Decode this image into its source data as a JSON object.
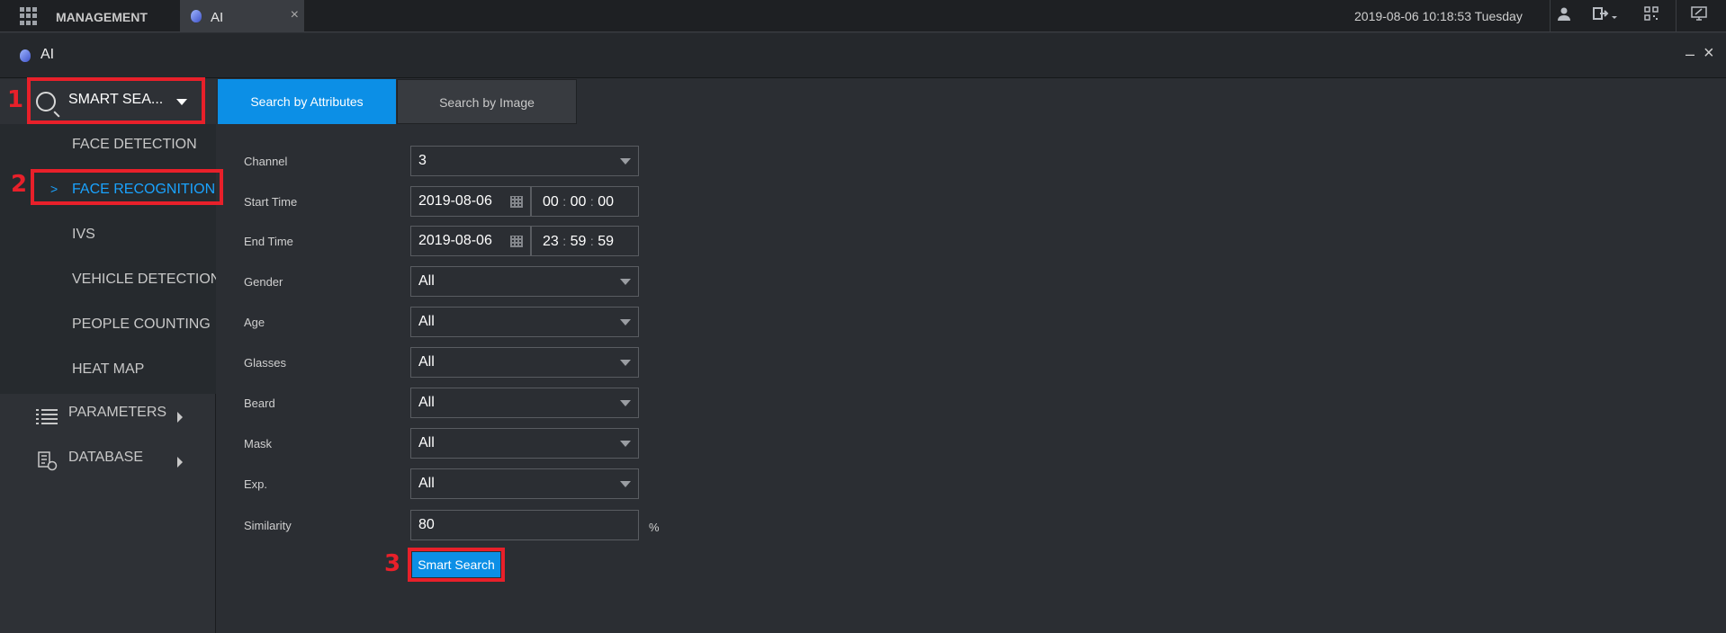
{
  "topbar": {
    "management_label": "MANAGEMENT",
    "tab_label": "AI",
    "tab_close": "×",
    "datetime": "2019-08-06 10:18:53 Tuesday",
    "icons": [
      "user-icon",
      "logout-icon",
      "qr-code-icon",
      "monitor-icon"
    ]
  },
  "window": {
    "title": "AI",
    "minimize": "–",
    "close": "×"
  },
  "sidebar": {
    "smart_search_label": "SMART SEA...",
    "sub_items": [
      {
        "label": "FACE DETECTION",
        "active": false
      },
      {
        "label": "FACE RECOGNITION",
        "active": true
      },
      {
        "label": "IVS",
        "active": false
      },
      {
        "label": "VEHICLE DETECTION",
        "active": false
      },
      {
        "label": "PEOPLE COUNTING",
        "active": false
      },
      {
        "label": "HEAT MAP",
        "active": false
      }
    ],
    "parameters_label": "PARAMETERS",
    "database_label": "DATABASE"
  },
  "tabs": {
    "by_attributes": "Search by Attributes",
    "by_image": "Search by Image"
  },
  "form": {
    "channel": {
      "label": "Channel",
      "value": "3"
    },
    "start_time": {
      "label": "Start Time",
      "date": "2019-08-06",
      "hh": "00",
      "mm": "00",
      "ss": "00"
    },
    "end_time": {
      "label": "End Time",
      "date": "2019-08-06",
      "hh": "23",
      "mm": "59",
      "ss": "59"
    },
    "gender": {
      "label": "Gender",
      "value": "All"
    },
    "age": {
      "label": "Age",
      "value": "All"
    },
    "glasses": {
      "label": "Glasses",
      "value": "All"
    },
    "beard": {
      "label": "Beard",
      "value": "All"
    },
    "mask": {
      "label": "Mask",
      "value": "All"
    },
    "exp": {
      "label": "Exp.",
      "value": "All"
    },
    "similarity": {
      "label": "Similarity",
      "value": "80",
      "unit": "%"
    },
    "search_button": "Smart Search"
  },
  "annotations": {
    "n1": "1",
    "n2": "2",
    "n3": "3"
  },
  "colors": {
    "accent": "#0c8fe6",
    "highlight": "#e8202a",
    "active_text": "#1aa3ff"
  }
}
